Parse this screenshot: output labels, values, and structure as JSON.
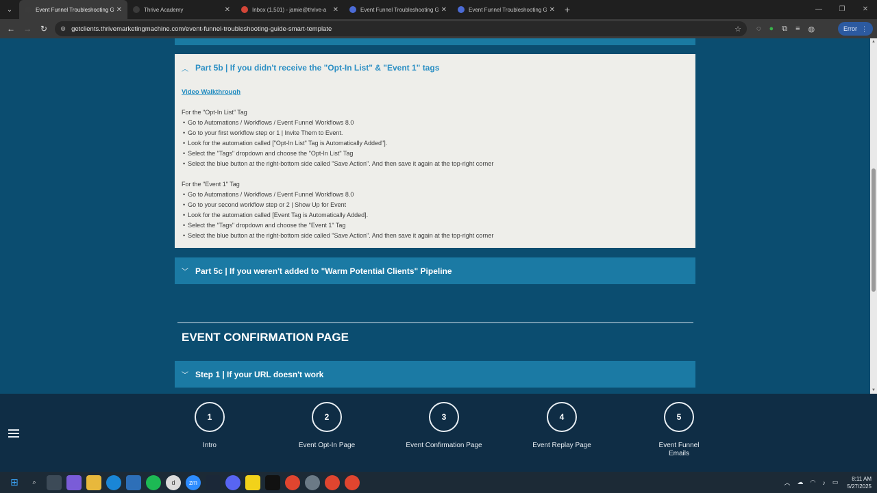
{
  "browser": {
    "tabs": [
      {
        "title": "Event Funnel Troubleshooting G",
        "active": true,
        "favicon_color": "#3b3b3b"
      },
      {
        "title": "Thrive Academy",
        "active": false,
        "favicon_color": "#3b3b3b"
      },
      {
        "title": "Inbox (1,501) - jamie@thrive-a",
        "active": false,
        "favicon_color": "#d44638"
      },
      {
        "title": "Event Funnel Troubleshooting G",
        "active": false,
        "favicon_color": "#4b6bd6"
      },
      {
        "title": "Event Funnel Troubleshooting G",
        "active": false,
        "favicon_color": "#4b6bd6"
      }
    ],
    "url": "getclients.thrivemarketingmachine.com/event-funnel-troubleshooting-guide-smart-template",
    "error_label": "Error"
  },
  "content": {
    "open_section": {
      "title": "Part 5b | If you didn't receive the \"Opt-In List\" & \"Event 1\" tags",
      "walkthrough_link": "Video Walkthrough",
      "groups": [
        {
          "heading": "For the \"Opt-In List\" Tag",
          "items": [
            "Go to Automations / Workflows / Event Funnel Workflows 8.0",
            "Go to your first workflow step or 1 | Invite Them to Event.",
            "Look for the automation called [\"Opt-In List\" Tag is Automatically Added\"].",
            "Select the \"Tags\" dropdown and choose the \"Opt-In List\" Tag",
            "Select the blue button at the right-bottom side called \"Save Action\". And then save it again at the top-right corner"
          ]
        },
        {
          "heading": "For the \"Event 1\" Tag",
          "items": [
            "Go to Automations / Workflows / Event Funnel Workflows 8.0",
            "Go to your second workflow step or 2 | Show Up for Event",
            "Look for the automation called [Event Tag is Automatically Added].",
            "Select the \"Tags\" dropdown and choose the \"Event 1\" Tag",
            "Select the blue button at the right-bottom side called \"Save Action\". And then save it again at the top-right corner"
          ]
        }
      ]
    },
    "closed_section_5c": "Part 5c | If you weren't added to \"Warm Potential Clients\" Pipeline",
    "section_heading": "EVENT CONFIRMATION PAGE",
    "closed_section_step1": "Step 1 | If your URL doesn't work"
  },
  "step_nav": [
    {
      "num": "1",
      "label": "Intro"
    },
    {
      "num": "2",
      "label": "Event Opt-In Page"
    },
    {
      "num": "3",
      "label": "Event Confirmation Page"
    },
    {
      "num": "4",
      "label": "Event Replay Page"
    },
    {
      "num": "5",
      "label": "Event Funnel Emails"
    }
  ],
  "taskbar": {
    "time": "8:11 AM",
    "date": "5/27/2025"
  }
}
